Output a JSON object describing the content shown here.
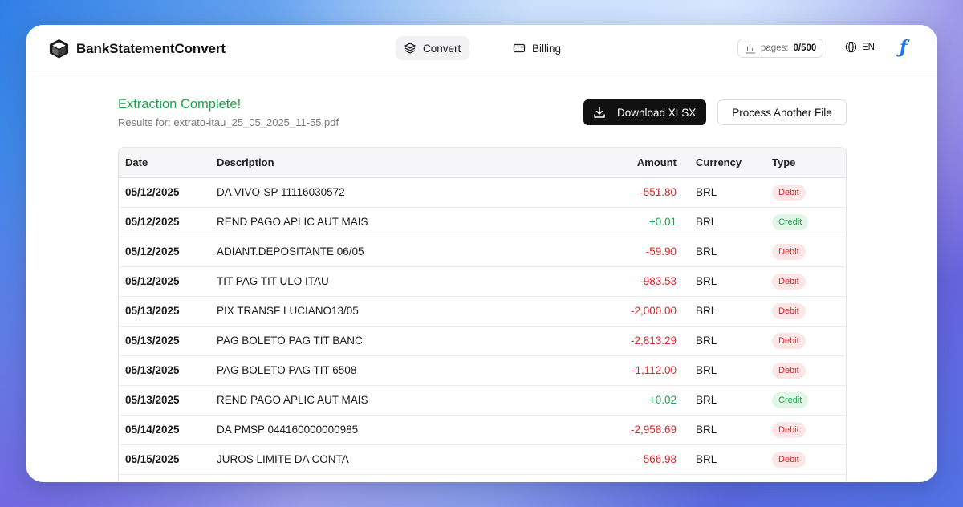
{
  "app": {
    "brand_name": "BankStatementConvert",
    "nav": {
      "convert_label": "Convert",
      "billing_label": "Billing"
    },
    "pages_label": "pages:",
    "pages_value": "0/500",
    "language": "EN"
  },
  "results": {
    "title": "Extraction Complete!",
    "subtitle": "Results for: extrato-itau_25_05_2025_11-55.pdf",
    "download_label": "Download XLSX",
    "process_label": "Process Another File"
  },
  "table": {
    "headers": {
      "date": "Date",
      "description": "Description",
      "amount": "Amount",
      "currency": "Currency",
      "type": "Type"
    },
    "rows": [
      {
        "date": "05/12/2025",
        "description": "DA VIVO-SP 11116030572",
        "amount": "-551.80",
        "currency": "BRL",
        "type": "Debit"
      },
      {
        "date": "05/12/2025",
        "description": "REND PAGO APLIC AUT MAIS",
        "amount": "+0.01",
        "currency": "BRL",
        "type": "Credit"
      },
      {
        "date": "05/12/2025",
        "description": "ADIANT.DEPOSITANTE 06/05",
        "amount": "-59.90",
        "currency": "BRL",
        "type": "Debit"
      },
      {
        "date": "05/12/2025",
        "description": "TIT PAG TIT ULO ITAU",
        "amount": "-983.53",
        "currency": "BRL",
        "type": "Debit"
      },
      {
        "date": "05/13/2025",
        "description": "PIX TRANSF LUCIANO13/05",
        "amount": "-2,000.00",
        "currency": "BRL",
        "type": "Debit"
      },
      {
        "date": "05/13/2025",
        "description": "PAG BOLETO PAG TIT BANC",
        "amount": "-2,813.29",
        "currency": "BRL",
        "type": "Debit"
      },
      {
        "date": "05/13/2025",
        "description": "PAG BOLETO PAG TIT 6508",
        "amount": "-1,112.00",
        "currency": "BRL",
        "type": "Debit"
      },
      {
        "date": "05/13/2025",
        "description": "REND PAGO APLIC AUT MAIS",
        "amount": "+0.02",
        "currency": "BRL",
        "type": "Credit"
      },
      {
        "date": "05/14/2025",
        "description": "DA PMSP 044160000000985",
        "amount": "-2,958.69",
        "currency": "BRL",
        "type": "Debit"
      },
      {
        "date": "05/15/2025",
        "description": "JUROS LIMITE DA CONTA",
        "amount": "-566.98",
        "currency": "BRL",
        "type": "Debit"
      }
    ]
  },
  "colors": {
    "success": "#1fa24a",
    "debit": "#d9262c",
    "primary_button": "#111111",
    "facebook_blue": "#1877f2"
  },
  "icons": {
    "brand": "cube-logo-icon",
    "convert": "layers-icon",
    "billing": "credit-card-icon",
    "pages": "bar-chart-icon",
    "language": "globe-icon",
    "download": "download-icon",
    "account": "facebook-icon"
  }
}
